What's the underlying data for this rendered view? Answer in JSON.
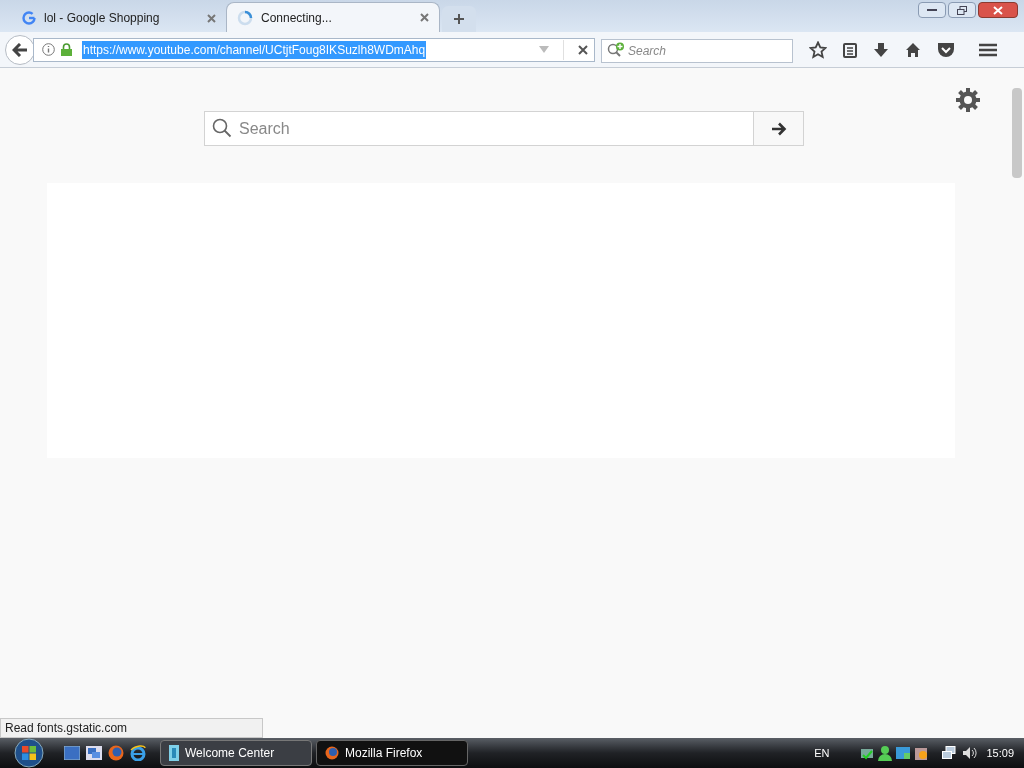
{
  "tabs": [
    {
      "title": "lol - Google Shopping",
      "kind": "google",
      "selected": false
    },
    {
      "title": "Connecting...",
      "kind": "loading",
      "selected": true
    }
  ],
  "address_bar": {
    "url": "https://www.youtube.com/channel/UCtjtFoug8IKSuzlh8WDmAhq",
    "url_selected": true
  },
  "search_bar": {
    "placeholder": "Search"
  },
  "page": {
    "search": {
      "placeholder": "Search"
    }
  },
  "status_bar": {
    "text": "Read fonts.gstatic.com"
  },
  "taskbar": {
    "windows": [
      {
        "title": "Welcome Center",
        "kind": "app",
        "selected": false
      },
      {
        "title": "Mozilla Firefox",
        "kind": "firefox",
        "selected": true
      }
    ],
    "language": "EN",
    "clock": "15:09"
  }
}
